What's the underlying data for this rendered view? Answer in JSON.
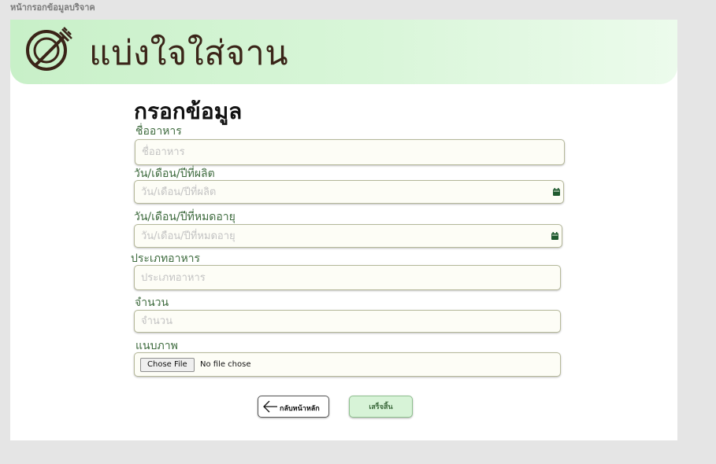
{
  "frame": {
    "label": "หน้ากรอกข้อมูลบริจาค"
  },
  "header": {
    "logo_icon": "plate-fork-icon",
    "title": "แบ่งใจใส่จาน"
  },
  "form": {
    "title": "กรอกข้อมูล",
    "fields": [
      {
        "label": "ชื่ออาหาร",
        "placeholder": "ชื่ออาหาร",
        "value": ""
      },
      {
        "label": "วัน/เดือน/ปีที่ผลิต",
        "placeholder": "วัน/เดือน/ปีที่ผลิต",
        "value": "",
        "icon": "calendar-icon"
      },
      {
        "label": "วัน/เดือน/ปีที่หมดอายุ",
        "placeholder": "วัน/เดือน/ปีที่หมดอายุ",
        "value": "",
        "icon": "calendar-icon"
      },
      {
        "label": "ประเภทอาหาร",
        "placeholder": "ประเภทอาหาร",
        "value": ""
      },
      {
        "label": "จำนวน",
        "placeholder": "จำนวน",
        "value": ""
      }
    ],
    "attachment": {
      "label": "แนบภาพ",
      "button_label": "Chose File",
      "status": "No file chose"
    }
  },
  "actions": {
    "back_label": "กลับหน้าหลัก",
    "back_icon": "arrow-left-icon",
    "done_label": "เสร็จสิ้น"
  },
  "colors": {
    "banner": "#c8f0c8",
    "accent_green": "#3e6b3e",
    "brand_brown": "#3a2418",
    "done_button": "#d7f3d7"
  }
}
